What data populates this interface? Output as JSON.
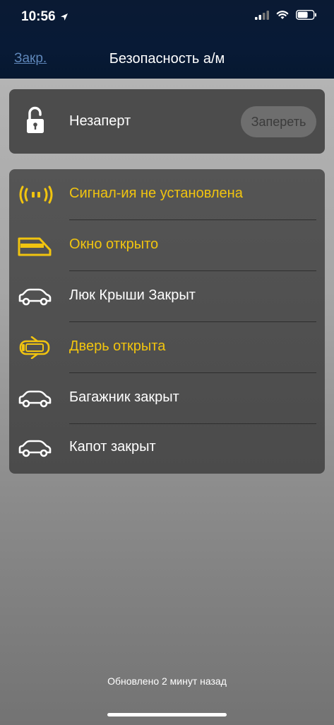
{
  "status": {
    "time": "10:56"
  },
  "nav": {
    "close_label": "Закр.",
    "title": "Безопасность а/м"
  },
  "lock": {
    "state_label": "Незаперт",
    "button_label": "Запереть"
  },
  "items": [
    {
      "label": "Сигнал-ия не установлена",
      "icon": "signal-waves-icon",
      "color": "#f1c40f"
    },
    {
      "label": "Окно открыто",
      "icon": "window-open-icon",
      "color": "#f1c40f"
    },
    {
      "label": "Люк Крыши Закрыт",
      "icon": "car-icon",
      "color": "#ffffff"
    },
    {
      "label": "Дверь открыта",
      "icon": "door-open-icon",
      "color": "#f1c40f"
    },
    {
      "label": "Багажник закрыт",
      "icon": "car-icon",
      "color": "#ffffff"
    },
    {
      "label": "Капот закрыт",
      "icon": "car-icon",
      "color": "#ffffff"
    }
  ],
  "footer": {
    "updated_text": "Обновлено 2 минут назад"
  }
}
